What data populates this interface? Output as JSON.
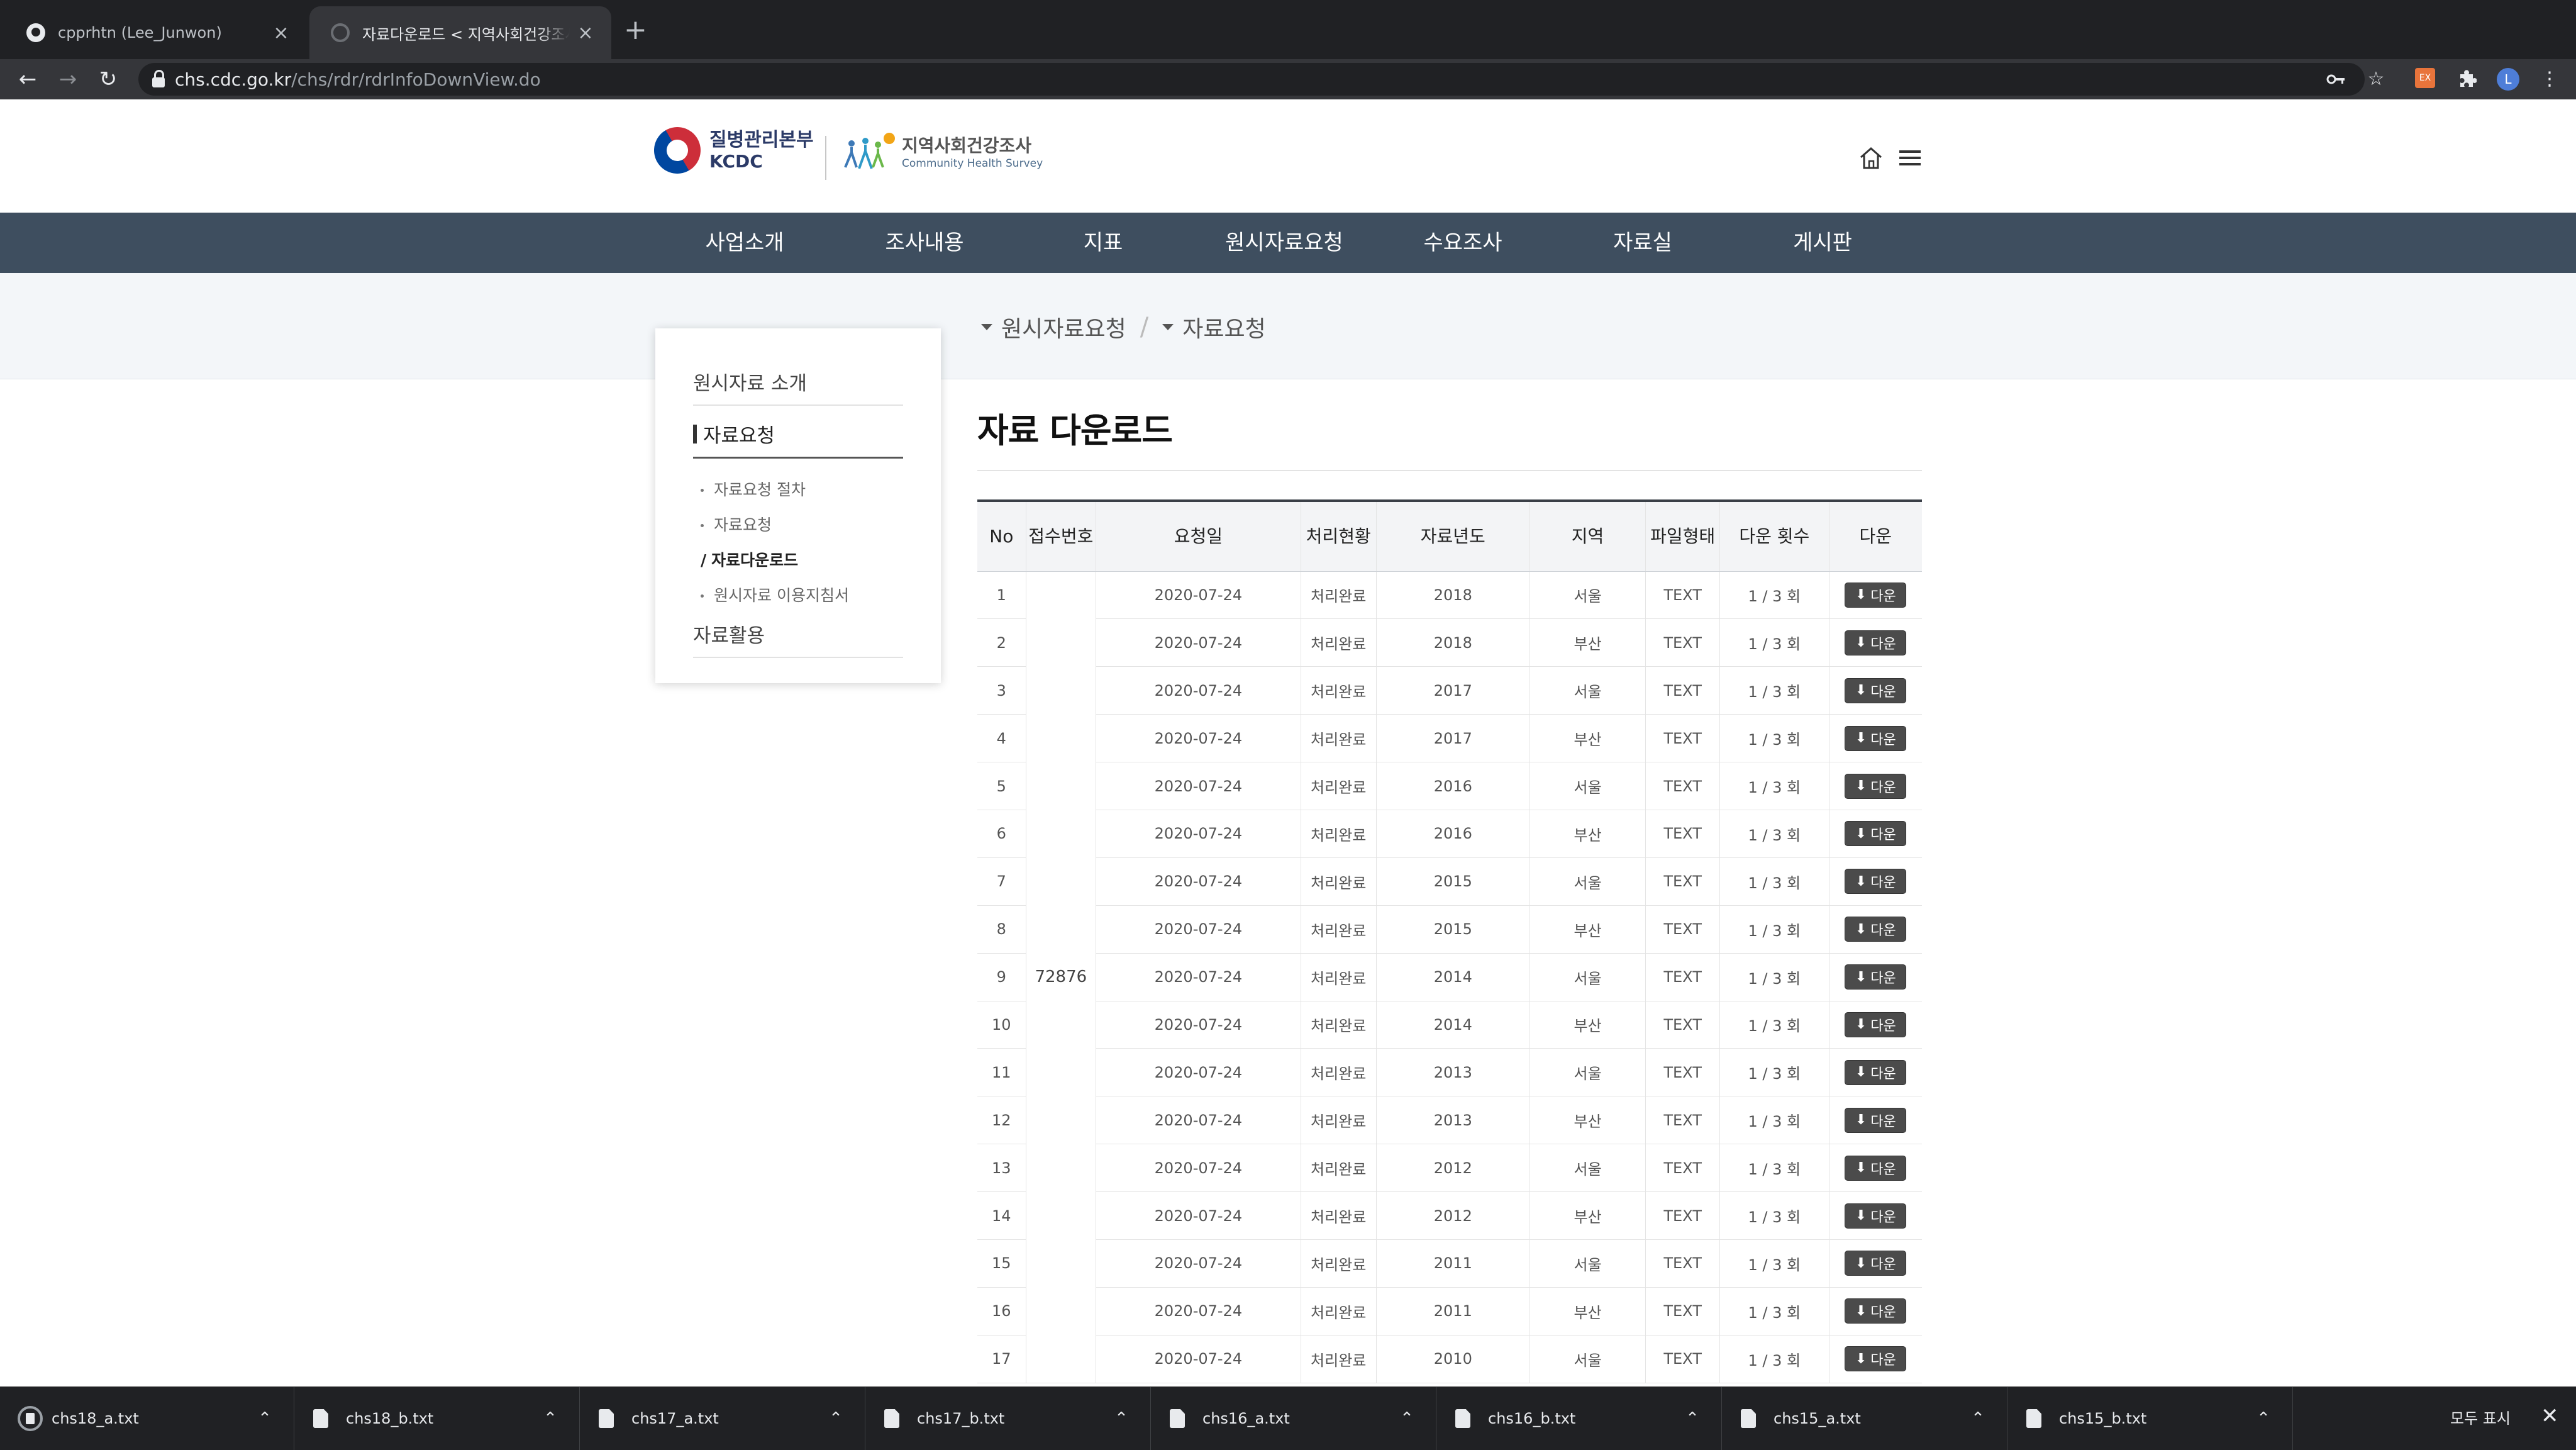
{
  "browser": {
    "tabs": [
      {
        "title": "cpprhtn (Lee_Junwon)",
        "close": "×"
      },
      {
        "title": "자료다운로드 < 지역사회건강조사 홈페이지",
        "close": "×"
      }
    ],
    "new_tab": "+",
    "url_host": "chs.cdc.go.kr",
    "url_path": "/chs/rdr/rdrInfoDownView.do",
    "extension_badge": "EX",
    "profile_initial": "L"
  },
  "header": {
    "kcdc_line1": "질병관리본부",
    "kcdc_line2": "KCDC",
    "chs_title": "지역사회건강조사",
    "chs_subtitle": "Community Health Survey"
  },
  "gnb": [
    "사업소개",
    "조사내용",
    "지표",
    "원시자료요청",
    "수요조사",
    "자료실",
    "게시판"
  ],
  "breadcrumb": [
    "원시자료요청",
    "자료요청"
  ],
  "lnb": {
    "heading1": "원시자료 소개",
    "heading2": "자료요청",
    "subs": [
      "자료요청 절차",
      "자료요청",
      "자료다운로드",
      "원시자료 이용지침서"
    ],
    "current_marker": "/",
    "heading3": "자료활용"
  },
  "page_title": "자료 다운로드",
  "table": {
    "headers": [
      "No",
      "접수번호",
      "요청일",
      "처리현황",
      "자료년도",
      "지역",
      "파일형태",
      "다운 횟수",
      "다운"
    ],
    "receipt_no": "72876",
    "button_label": "다운",
    "button_icon": "⬇",
    "rows": [
      {
        "no": "1",
        "date": "2020-07-24",
        "status": "처리완료",
        "year": "2018",
        "region": "서울",
        "type": "TEXT",
        "count": "1 / 3 회"
      },
      {
        "no": "2",
        "date": "2020-07-24",
        "status": "처리완료",
        "year": "2018",
        "region": "부산",
        "type": "TEXT",
        "count": "1 / 3 회"
      },
      {
        "no": "3",
        "date": "2020-07-24",
        "status": "처리완료",
        "year": "2017",
        "region": "서울",
        "type": "TEXT",
        "count": "1 / 3 회"
      },
      {
        "no": "4",
        "date": "2020-07-24",
        "status": "처리완료",
        "year": "2017",
        "region": "부산",
        "type": "TEXT",
        "count": "1 / 3 회"
      },
      {
        "no": "5",
        "date": "2020-07-24",
        "status": "처리완료",
        "year": "2016",
        "region": "서울",
        "type": "TEXT",
        "count": "1 / 3 회"
      },
      {
        "no": "6",
        "date": "2020-07-24",
        "status": "처리완료",
        "year": "2016",
        "region": "부산",
        "type": "TEXT",
        "count": "1 / 3 회"
      },
      {
        "no": "7",
        "date": "2020-07-24",
        "status": "처리완료",
        "year": "2015",
        "region": "서울",
        "type": "TEXT",
        "count": "1 / 3 회"
      },
      {
        "no": "8",
        "date": "2020-07-24",
        "status": "처리완료",
        "year": "2015",
        "region": "부산",
        "type": "TEXT",
        "count": "1 / 3 회"
      },
      {
        "no": "9",
        "date": "2020-07-24",
        "status": "처리완료",
        "year": "2014",
        "region": "서울",
        "type": "TEXT",
        "count": "1 / 3 회"
      },
      {
        "no": "10",
        "date": "2020-07-24",
        "status": "처리완료",
        "year": "2014",
        "region": "부산",
        "type": "TEXT",
        "count": "1 / 3 회"
      },
      {
        "no": "11",
        "date": "2020-07-24",
        "status": "처리완료",
        "year": "2013",
        "region": "서울",
        "type": "TEXT",
        "count": "1 / 3 회"
      },
      {
        "no": "12",
        "date": "2020-07-24",
        "status": "처리완료",
        "year": "2013",
        "region": "부산",
        "type": "TEXT",
        "count": "1 / 3 회"
      },
      {
        "no": "13",
        "date": "2020-07-24",
        "status": "처리완료",
        "year": "2012",
        "region": "서울",
        "type": "TEXT",
        "count": "1 / 3 회"
      },
      {
        "no": "14",
        "date": "2020-07-24",
        "status": "처리완료",
        "year": "2012",
        "region": "부산",
        "type": "TEXT",
        "count": "1 / 3 회"
      },
      {
        "no": "15",
        "date": "2020-07-24",
        "status": "처리완료",
        "year": "2011",
        "region": "서울",
        "type": "TEXT",
        "count": "1 / 3 회"
      },
      {
        "no": "16",
        "date": "2020-07-24",
        "status": "처리완료",
        "year": "2011",
        "region": "부산",
        "type": "TEXT",
        "count": "1 / 3 회"
      },
      {
        "no": "17",
        "date": "2020-07-24",
        "status": "처리완료",
        "year": "2010",
        "region": "서울",
        "type": "TEXT",
        "count": "1 / 3 회"
      }
    ]
  },
  "downloads": {
    "files": [
      "chs18_a.txt",
      "chs18_b.txt",
      "chs17_a.txt",
      "chs17_b.txt",
      "chs16_a.txt",
      "chs16_b.txt",
      "chs15_a.txt",
      "chs15_b.txt"
    ],
    "show_all": "모두 표시",
    "close": "✕"
  },
  "colors": {
    "gnb_bg": "#3e4e5f",
    "sub_band": "#f3f6f9",
    "button_bg": "#4b4b4b",
    "chrome_bg": "#202124"
  },
  "icons": [
    "github-icon",
    "globe-icon",
    "back-icon",
    "forward-icon",
    "reload-icon",
    "lock-icon",
    "key-icon",
    "star-icon",
    "extension-icon",
    "puzzle-icon",
    "menu-dots-icon",
    "home-icon",
    "hamburger-icon",
    "download-icon",
    "file-icon",
    "chevron-up-icon",
    "close-icon"
  ]
}
